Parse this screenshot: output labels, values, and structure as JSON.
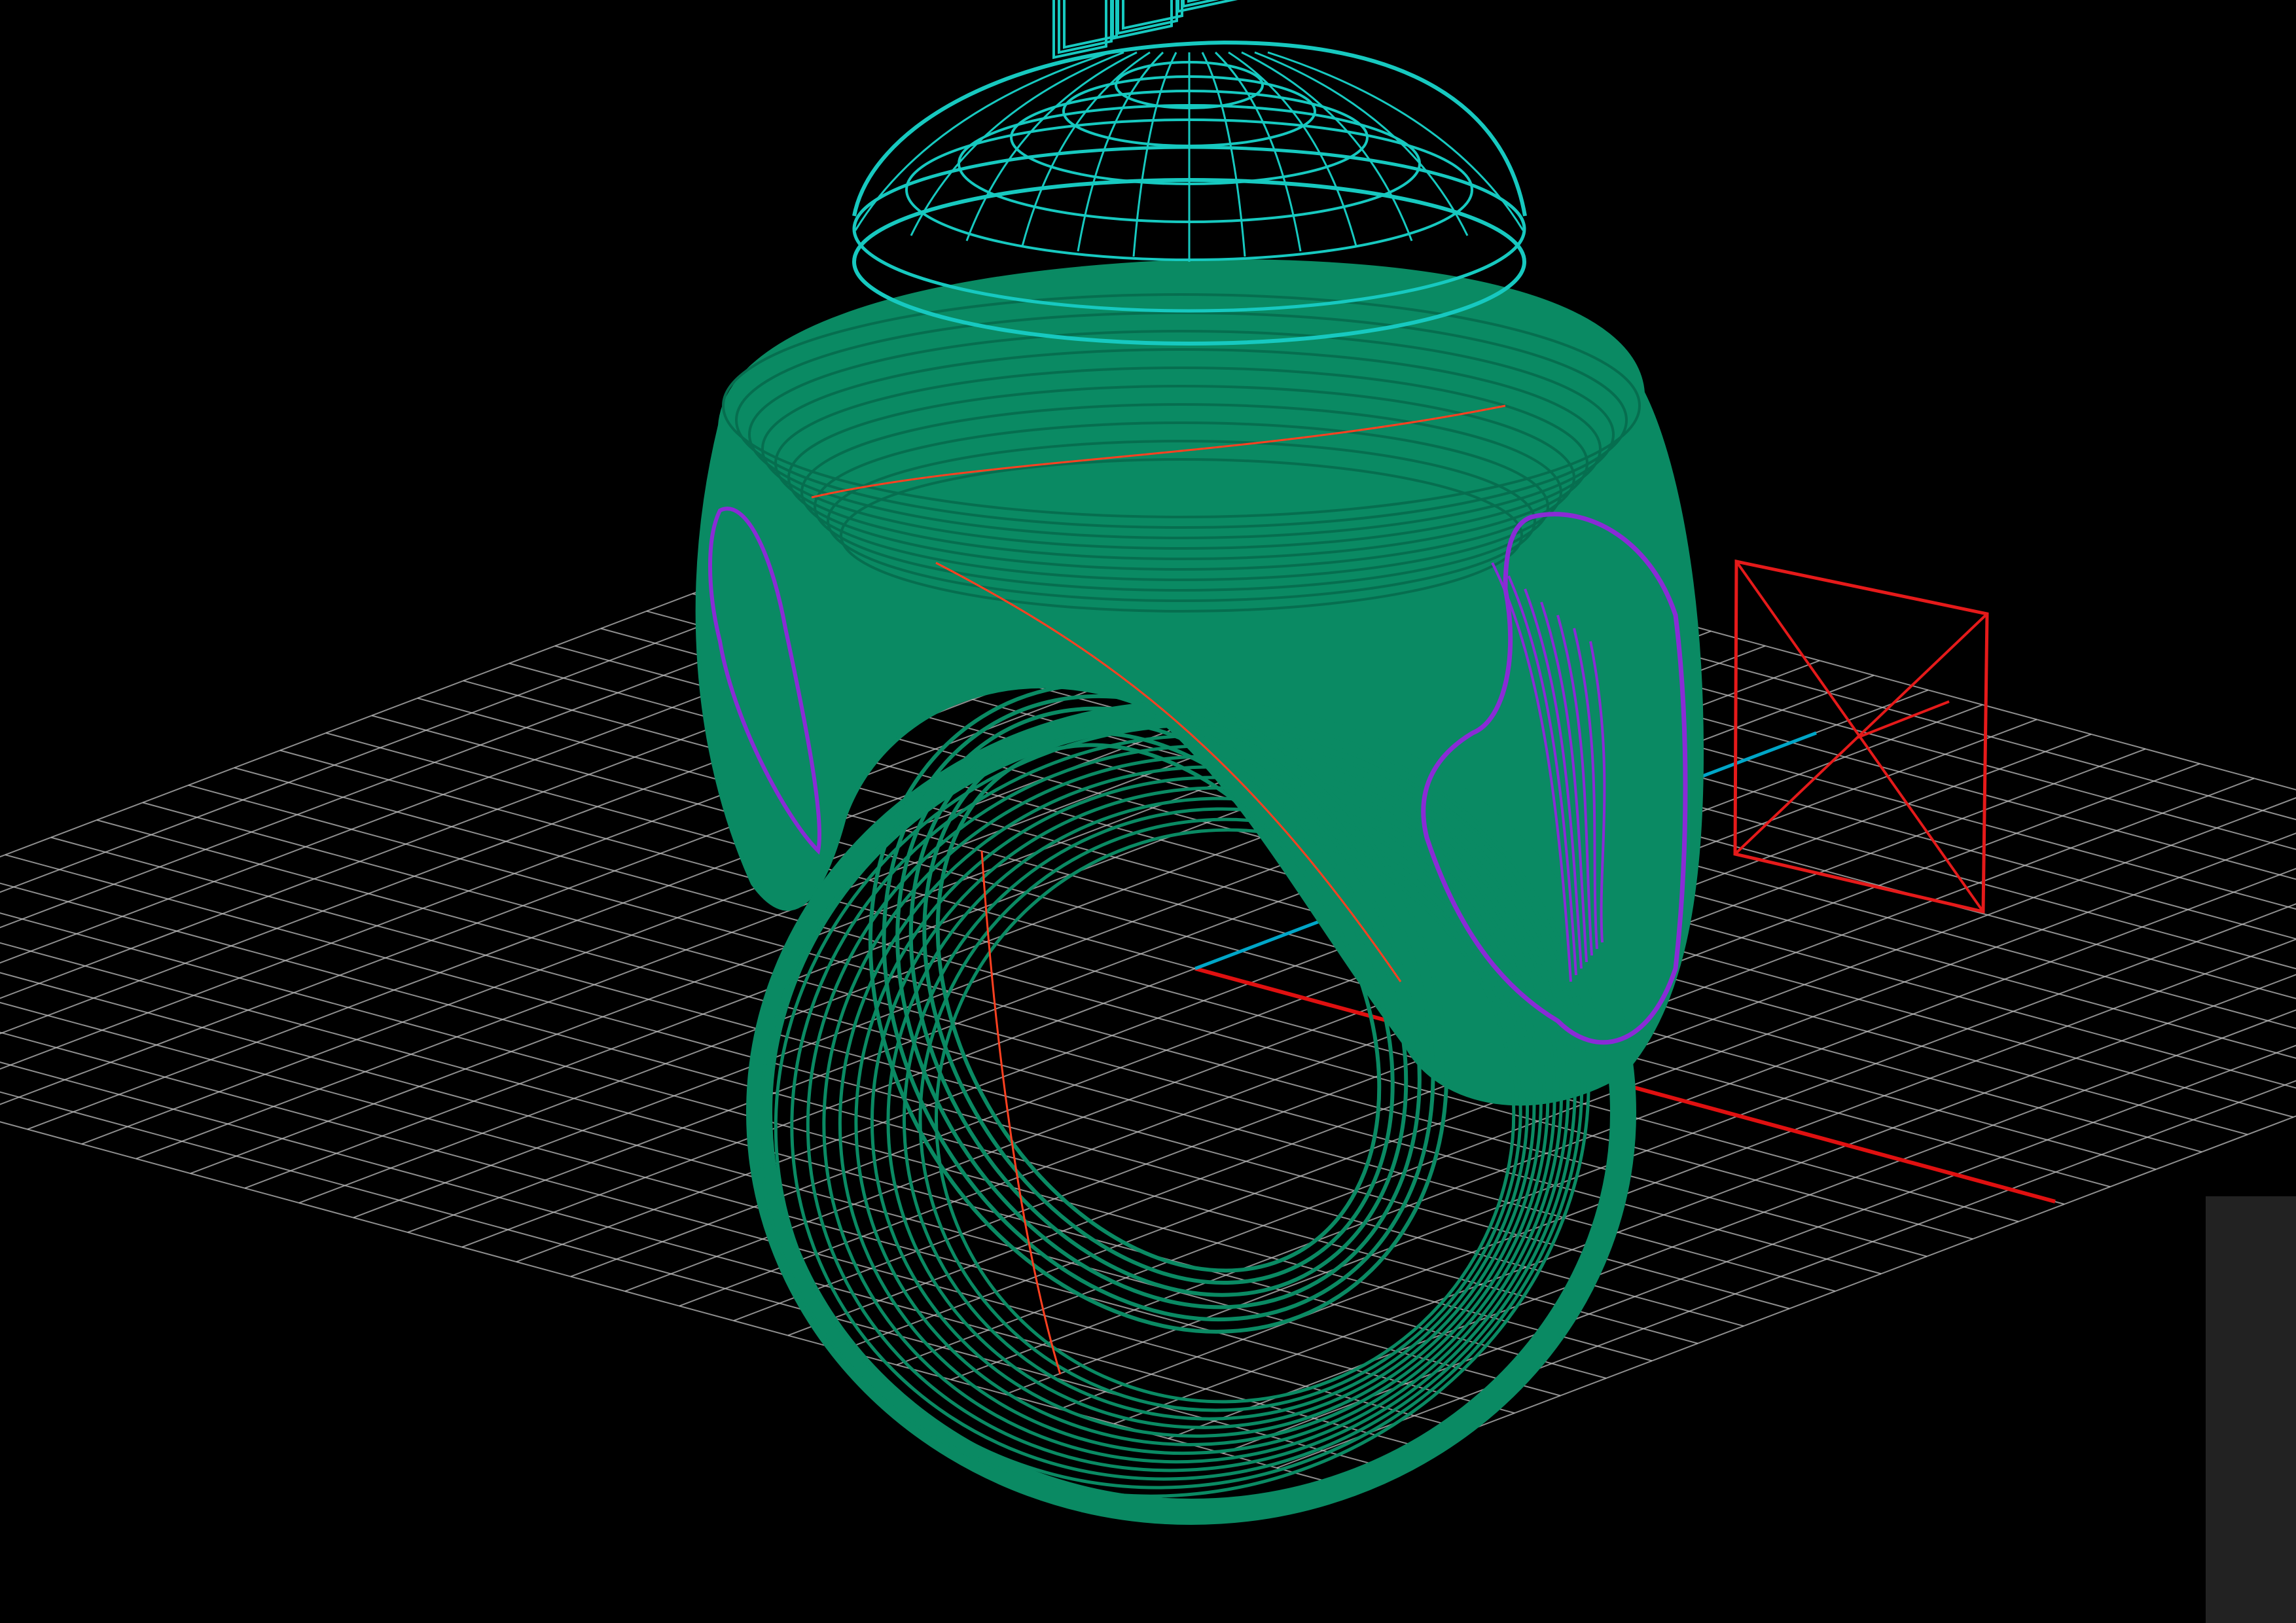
{
  "viewport": {
    "mode": "wireframe",
    "background": "#000000",
    "colors": {
      "grid": "#bdbdbd",
      "x_axis": "#e01010",
      "y_axis": "#00a6c8",
      "ring_body": "#0a8a63",
      "stone": "#17c9c0",
      "relief": "#8a2bd6",
      "seam": "#ff4020",
      "camera_marker": "#e51a1a",
      "side_panel": "#222222"
    },
    "objects": {
      "grid": "ground-plane-grid",
      "ring": "signet-ring-wireframe",
      "stone": "cabochon-dome-wireframe",
      "lettering": "stone-lettering-wireframe",
      "relief": "shank-relief-ornament",
      "camera": "camera-target-marker"
    }
  }
}
